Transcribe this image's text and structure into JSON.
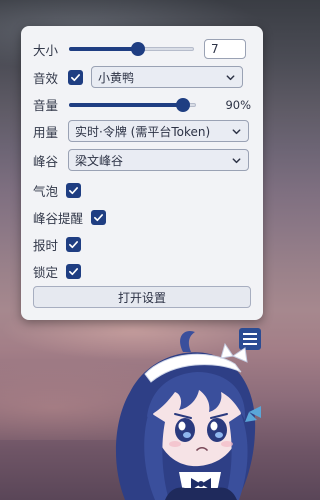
{
  "panel": {
    "size": {
      "label": "大小",
      "value": 0.55,
      "input_value": "7"
    },
    "sound_effect": {
      "label": "音效",
      "checked": true,
      "select_value": "小黄鸭"
    },
    "volume": {
      "label": "音量",
      "value": 0.9,
      "display": "90%"
    },
    "usage": {
      "label": "用量",
      "select_value": "实时·令牌 (需平台Token)"
    },
    "peak": {
      "label": "峰谷",
      "select_value": "梁文峰谷"
    },
    "bubble": {
      "label": "气泡",
      "checked": true
    },
    "peak_reminder": {
      "label": "峰谷提醒",
      "checked": true
    },
    "time_announce": {
      "label": "报时",
      "checked": true
    },
    "lock": {
      "label": "锁定",
      "checked": true
    },
    "open_settings_label": "打开设置"
  },
  "menu_button": {
    "icon": "hamburger-menu-icon"
  },
  "colors": {
    "accent": "#1f3e82",
    "panel_bg": "#f2f3f6",
    "menu_button_bg": "#2b4c93"
  }
}
